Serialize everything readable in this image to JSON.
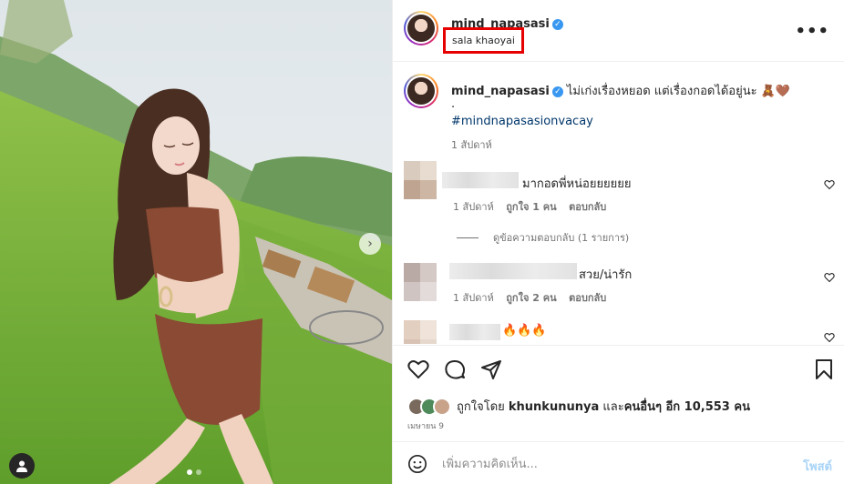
{
  "post": {
    "username": "mind_napasasi",
    "location": "sala khaoyai",
    "more_icon": "more-horizontal-icon"
  },
  "caption": {
    "username": "mind_napasasi",
    "text": "ไม่เก่งเรื่องหยอด แต่เรื่องกอดได้อยู่นะ 🧸🤎",
    "dot": ".",
    "hashtag": "#mindnapasasionvacay",
    "time": "1 สัปดาห์"
  },
  "comments": [
    {
      "text": "มากอดพี่หน่อยยยยยย",
      "time": "1 สัปดาห์",
      "likes": "ถูกใจ 1 คน",
      "reply": "ตอบกลับ",
      "view_replies": "ดูข้อความตอบกลับ (1 รายการ)"
    },
    {
      "text": "สวย/น่ารัก",
      "time": "1 สัปดาห์",
      "likes": "ถูกใจ 2 คน",
      "reply": "ตอบกลับ"
    },
    {
      "text": "🔥🔥🔥"
    }
  ],
  "actions": {
    "like_icon": "heart-icon",
    "comment_icon": "comment-icon",
    "share_icon": "share-icon",
    "save_icon": "bookmark-icon"
  },
  "likes": {
    "prefix": "ถูกใจโดย ",
    "user": "khunkununya",
    "middle": " และ",
    "others": "คนอื่นๆ อีก 10,553 คน"
  },
  "date": "เมษายน 9",
  "add_comment": {
    "placeholder": "เพิ่มความคิดเห็น...",
    "post_label": "โพสต์"
  },
  "colors": {
    "accent_blue": "#0095f6",
    "verified_blue": "#3897f0",
    "highlight_red": "#e60000"
  }
}
